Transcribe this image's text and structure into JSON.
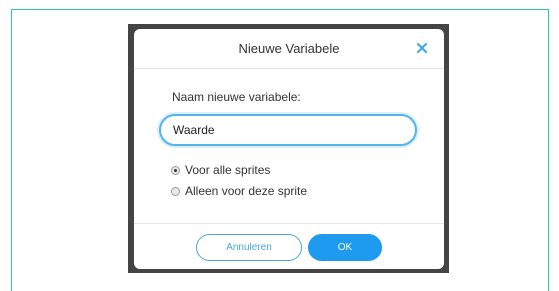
{
  "dialog": {
    "title": "Nieuwe Variabele",
    "close_icon": "close-icon",
    "field_label": "Naam nieuwe variabele:",
    "input_value": "Waarde",
    "options": [
      {
        "label": "Voor alle sprites",
        "checked": true
      },
      {
        "label": "Alleen voor deze sprite",
        "checked": false
      }
    ],
    "cancel_label": "Annuleren",
    "ok_label": "OK"
  },
  "colors": {
    "frame_border": "#2fc7a5",
    "accent": "#1e9bf0",
    "input_border": "#52b5ea",
    "close_icon": "#3aa7e8"
  }
}
